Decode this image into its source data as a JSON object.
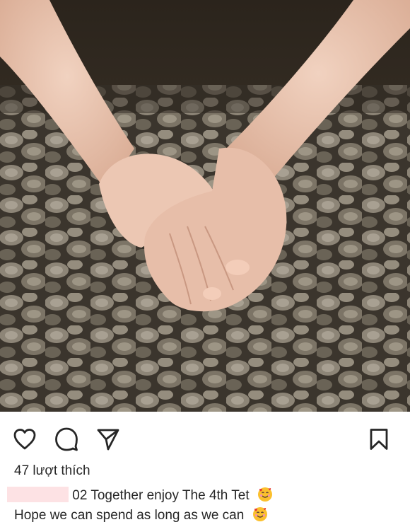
{
  "post": {
    "image_alt": "Two hands holding each other over a pile of dried wood",
    "actions": {
      "like_icon": "heart-outline-icon",
      "comment_icon": "comment-bubble-icon",
      "share_icon": "paper-plane-icon",
      "save_icon": "bookmark-outline-icon"
    },
    "likes_text": "47 lượt thích",
    "caption": {
      "line1": "02 Together enjoy The 4th Tet",
      "line2": "Hope we can spend as long as we can",
      "emoji": "smiling-face-with-hearts-icon"
    }
  },
  "colors": {
    "text": "#262626",
    "redaction": "#fde2e4"
  }
}
